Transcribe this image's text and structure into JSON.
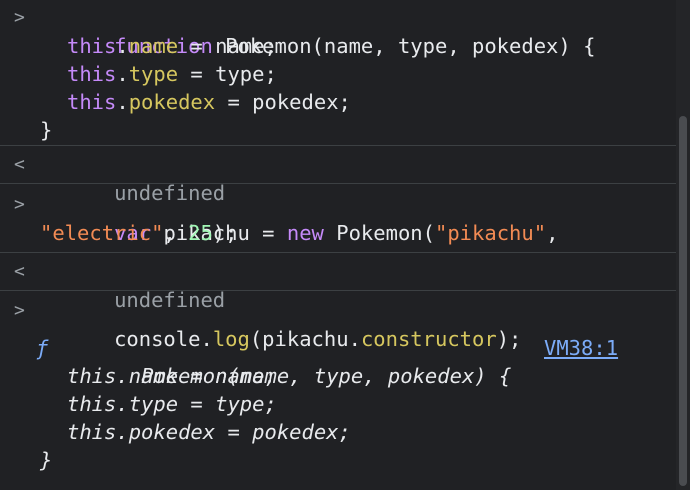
{
  "entries": [
    {
      "type": "input",
      "lines": [
        [
          "function ",
          "Pokemon(name, type, pokedex) {"
        ],
        [
          "this",
          ".",
          "name",
          " = name;"
        ],
        [
          "this",
          ".",
          "type",
          " = type;"
        ],
        [
          "this",
          ".",
          "pokedex",
          " = pokedex;"
        ],
        [
          "}"
        ]
      ]
    },
    {
      "type": "result",
      "text": "undefined"
    },
    {
      "type": "input",
      "line1": [
        "var ",
        "pikachu = ",
        "new ",
        "Pokemon(",
        "\"pikachu\"",
        ","
      ],
      "line2": [
        "\"electric\"",
        ", ",
        "25",
        ");"
      ]
    },
    {
      "type": "result",
      "text": "undefined"
    },
    {
      "type": "input",
      "line1": [
        "console.",
        "log",
        "(pikachu.",
        "constructor",
        ");"
      ]
    },
    {
      "type": "output",
      "f_symbol": "ƒ",
      "link": "VM38:1",
      "lines": [
        "Pokemon(name, type, pokedex) {",
        "this.name = name;",
        "this.type = type;",
        "this.pokedex = pokedex;",
        "}"
      ]
    }
  ]
}
